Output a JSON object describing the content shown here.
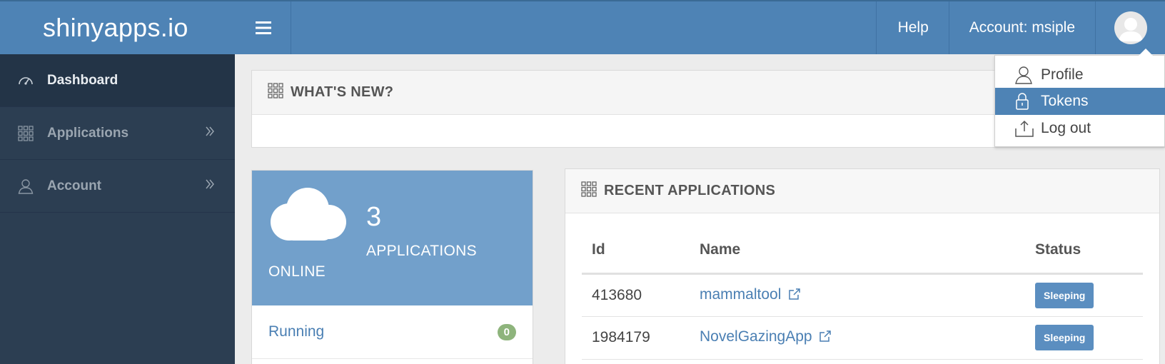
{
  "header": {
    "brand": "shinyapps.io",
    "help_label": "Help",
    "account_label": "Account:  msiple"
  },
  "account_menu": {
    "items": [
      {
        "label": "Profile",
        "icon": "user-icon"
      },
      {
        "label": "Tokens",
        "icon": "lock-icon",
        "active": true
      },
      {
        "label": "Log out",
        "icon": "upload-icon"
      }
    ]
  },
  "sidebar": {
    "items": [
      {
        "label": "Dashboard",
        "icon": "dashboard-icon",
        "active": true
      },
      {
        "label": "Applications",
        "icon": "grid-icon"
      },
      {
        "label": "Account",
        "icon": "user-icon"
      }
    ]
  },
  "whats_new": {
    "title": "WHAT'S NEW?"
  },
  "stat_card": {
    "count": "3",
    "label": "APPLICATIONS",
    "sublabel": "ONLINE",
    "rows": [
      {
        "label": "Running",
        "count": "0"
      }
    ]
  },
  "recent_apps": {
    "title": "RECENT APPLICATIONS",
    "columns": [
      "Id",
      "Name",
      "Status"
    ],
    "rows": [
      {
        "id": "413680",
        "name": "mammaltool",
        "status": "Sleeping"
      },
      {
        "id": "1984179",
        "name": "NovelGazingApp",
        "status": "Sleeping"
      }
    ]
  },
  "colors": {
    "topbar": "#4e83b5",
    "sidebar": "#2c3e52",
    "stat_card": "#72a0cb",
    "running_badge": "#8eb47c",
    "status_badge": "#5b8ec0"
  }
}
